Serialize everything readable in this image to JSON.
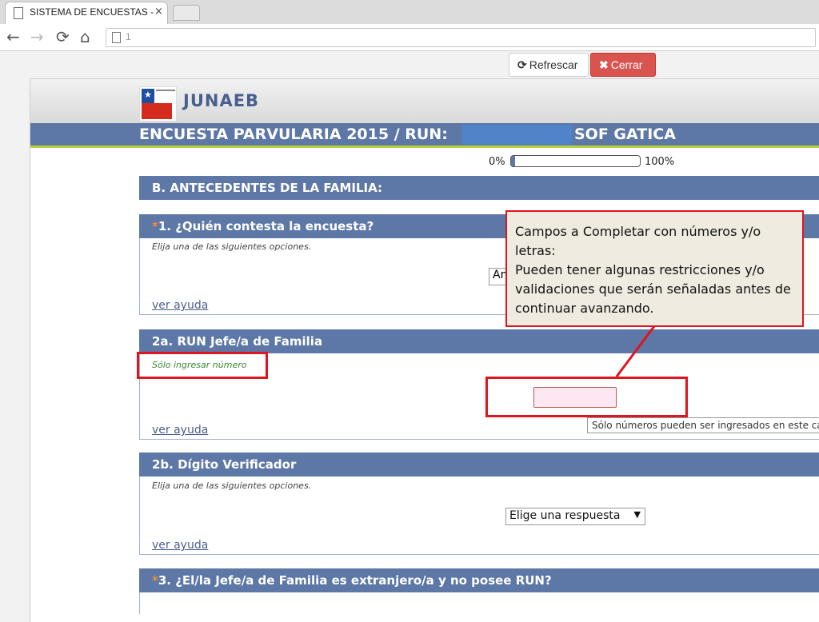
{
  "browser": {
    "tab_title": "SISTEMA DE ENCUESTAS -",
    "tab_close": "×",
    "back": "←",
    "forward": "→",
    "reload": "⟳",
    "home": "⌂",
    "url": "1"
  },
  "top_buttons": {
    "refresh_icon": "⟳",
    "refresh_label": "Refrescar",
    "close_icon": "✖",
    "close_label": "Cerrar"
  },
  "header": {
    "brand": "JUNAEB",
    "title_left": "ENCUESTA PARVULARIA 2015 / RUN:",
    "title_right": "SOF GATICA"
  },
  "progress": {
    "min_label": "0%",
    "max_label": "100%",
    "value_percent": 3
  },
  "section": {
    "title": "B. ANTECEDENTES DE LA FAMILIA:"
  },
  "questions": {
    "q1": {
      "required_mark": "*",
      "title": "1. ¿Quién contesta la encuesta?",
      "help": "Elija una de las siguientes opciones.",
      "selected": "An",
      "help_link": "ver ayuda"
    },
    "q2a": {
      "title": "2a. RUN  Jefe/a de Familia",
      "help": "Sólo ingresar número",
      "input_value": "",
      "tooltip": "Sólo números pueden ser ingresados en este campo",
      "help_link": "ver ayuda"
    },
    "q2b": {
      "title": "2b. Dígito Verificador",
      "help": "Elija una de las siguientes opciones.",
      "selected": "Elige una respuesta",
      "arrow": "▼",
      "help_link": "ver ayuda"
    },
    "q3": {
      "required_mark": "*",
      "title": "3. ¿El/la Jefe/a de Familia es extranjero/a y no posee RUN?"
    }
  },
  "callout": {
    "lines": [
      "Campos a Completar con números y/o",
      "letras:",
      "Pueden tener algunas restricciones y/o",
      "validaciones que serán señaladas antes de",
      "continuar avanzando."
    ]
  },
  "colors": {
    "header_blue": "#5d78a6",
    "annotation_red": "#e0141e",
    "close_red": "#d9534f",
    "accent_green": "#b9d23c"
  }
}
